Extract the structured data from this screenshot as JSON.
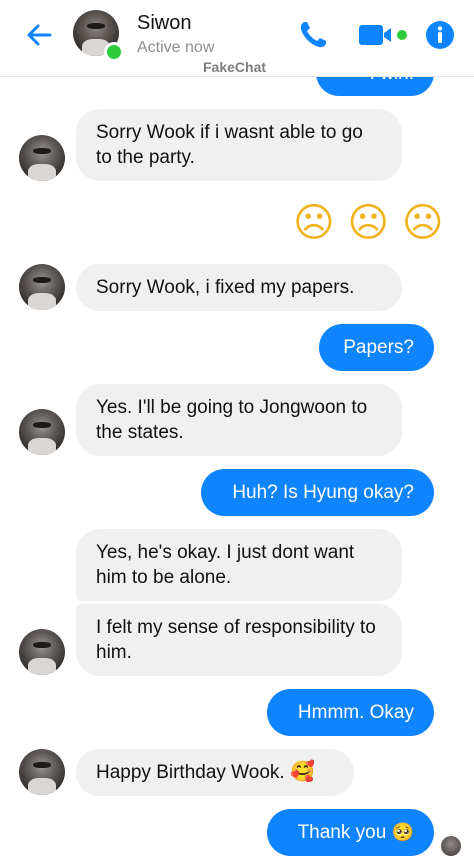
{
  "header": {
    "contact_name": "Siwon",
    "status": "Active now",
    "brand": "FakeChat",
    "icons": [
      "back-arrow-icon",
      "phone-icon",
      "video-camera-icon",
      "info-icon"
    ],
    "accent_color": "#0f84ff",
    "online_color": "#2ccc3a"
  },
  "messages": {
    "m0_partial": "I win!",
    "m1": "Sorry Wook if i wasnt able to go to the party.",
    "m2_emoji": "☹ ☹ ☹",
    "m3": "Sorry Wook, i fixed my papers.",
    "m4": "Papers?",
    "m5": "Yes. I'll be going to Jongwoon to the states.",
    "m6": "Huh? Is Hyung okay?",
    "m7": "Yes, he's okay. I just dont want him to be alone.",
    "m8": "I felt my sense of responsibility to him.",
    "m9": "Hmmm. Okay",
    "m10": "Happy Birthday Wook.",
    "m10_emoji": "🥰",
    "m11": "Thank you",
    "m11_emoji": "🥺"
  },
  "colors": {
    "incoming_bubble": "#f1f0f0",
    "outgoing_bubble": "#0f84ff"
  }
}
